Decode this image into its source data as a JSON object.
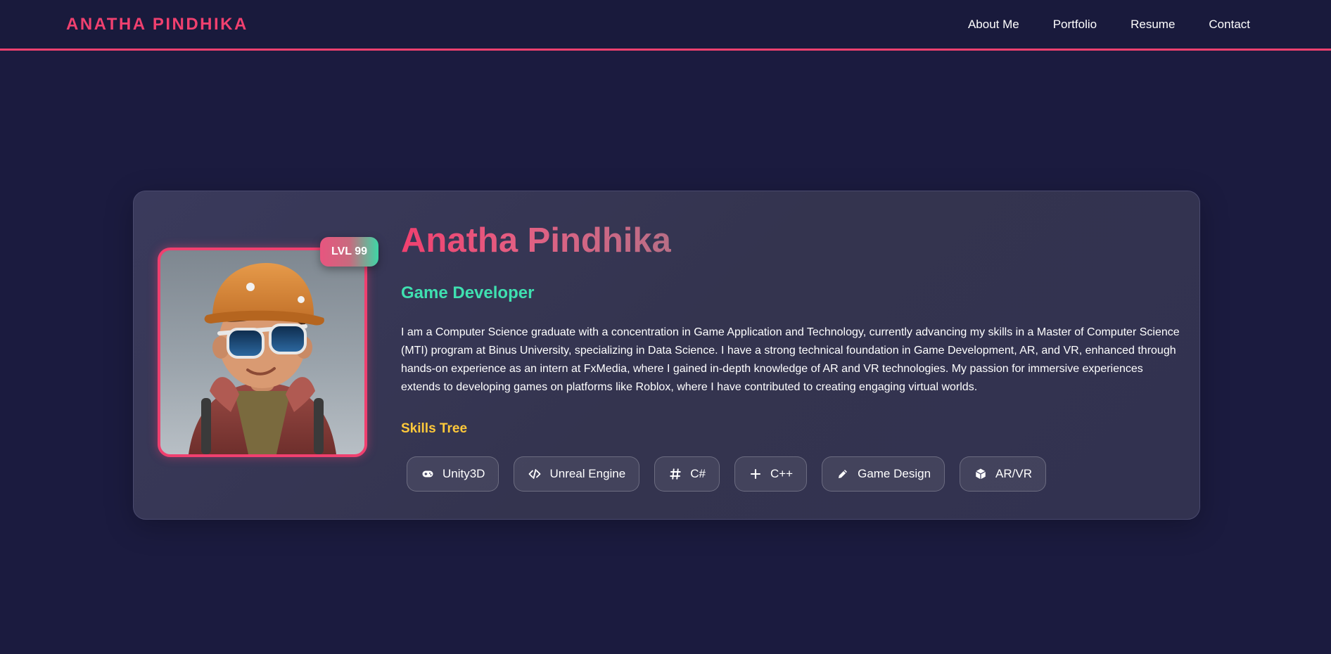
{
  "header": {
    "brand": "ANATHA PINDHIKA",
    "nav": [
      "About Me",
      "Portfolio",
      "Resume",
      "Contact"
    ]
  },
  "profile": {
    "level_badge": "LVL 99",
    "name": "Anatha Pindhika",
    "role": "Game Developer",
    "bio": "I am a Computer Science graduate with a concentration in Game Application and Technology, currently advancing my skills in a Master of Computer Science (MTI) program at Binus University, specializing in Data Science. I have a strong technical foundation in Game Development, AR, and VR, enhanced through hands-on experience as an intern at FxMedia, where I gained in-depth knowledge of AR and VR technologies. My passion for immersive experiences extends to developing games on platforms like Roblox, where I have contributed to creating engaging virtual worlds."
  },
  "skills": {
    "title": "Skills Tree",
    "items": [
      {
        "label": "Unity3D",
        "icon": "gamepad-icon"
      },
      {
        "label": "Unreal Engine",
        "icon": "code-icon"
      },
      {
        "label": "C#",
        "icon": "hashtag-icon"
      },
      {
        "label": "C++",
        "icon": "plus-icon"
      },
      {
        "label": "Game Design",
        "icon": "pencil-icon"
      },
      {
        "label": "AR/VR",
        "icon": "cube-icon"
      }
    ]
  },
  "colors": {
    "accent": "#f0406f",
    "role": "#3fe0b0",
    "skills_title": "#ffc93a",
    "background": "#1b1b3f"
  }
}
